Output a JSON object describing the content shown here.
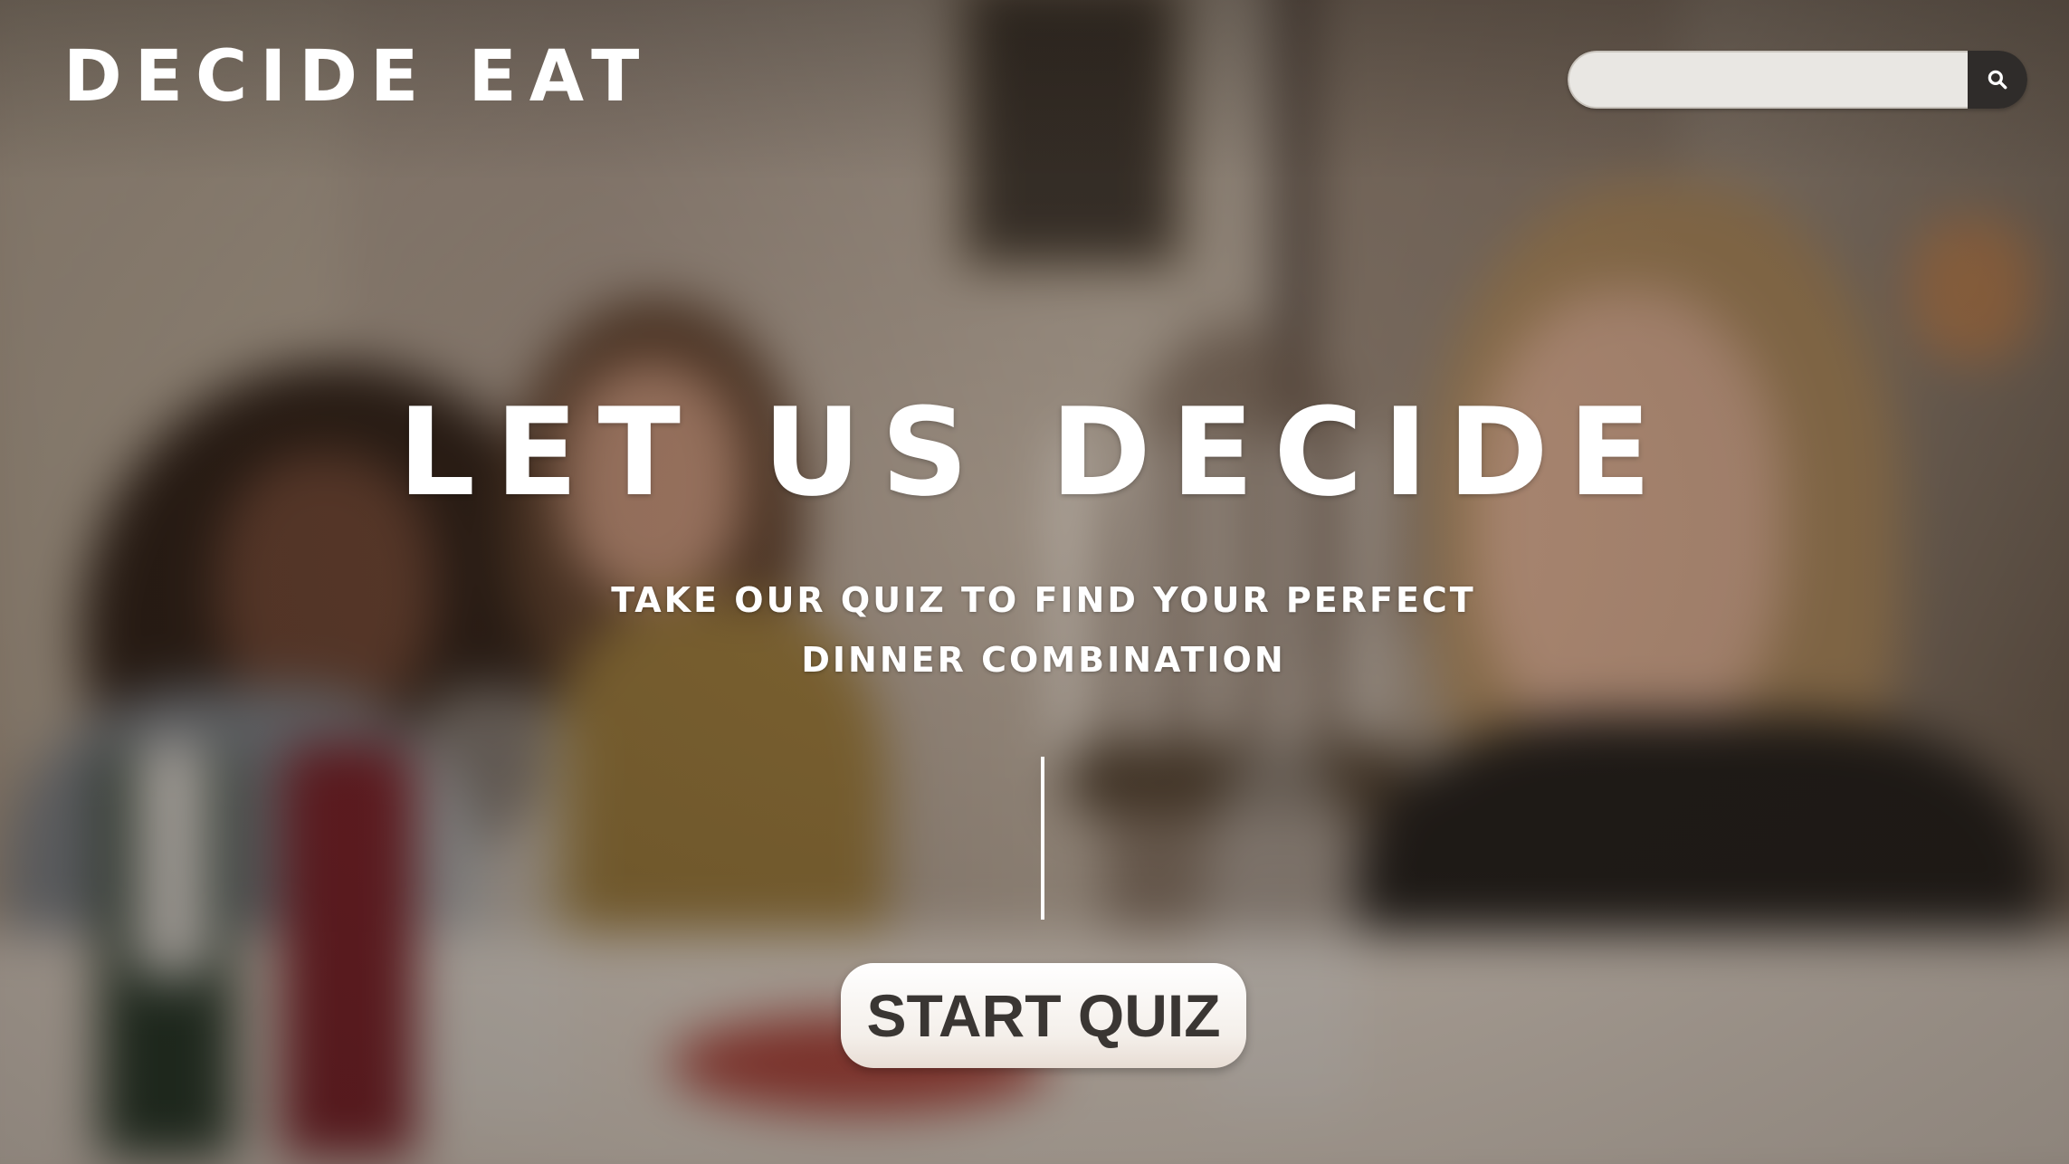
{
  "header": {
    "logo_text": "DECIDE EAT",
    "search": {
      "value": "",
      "placeholder": "",
      "button_icon": "search-icon"
    }
  },
  "hero": {
    "title": "LET US DECIDE",
    "subtitle": "TAKE OUR QUIZ TO FIND YOUR PERFECT DINNER COMBINATION",
    "cta_label": "START QUIZ"
  },
  "colors": {
    "text": "#ffffff",
    "search_field": "#e9e7e3",
    "search_button": "#2f2c2a",
    "cta_background": "#f4efea",
    "cta_text": "#3a3633"
  }
}
